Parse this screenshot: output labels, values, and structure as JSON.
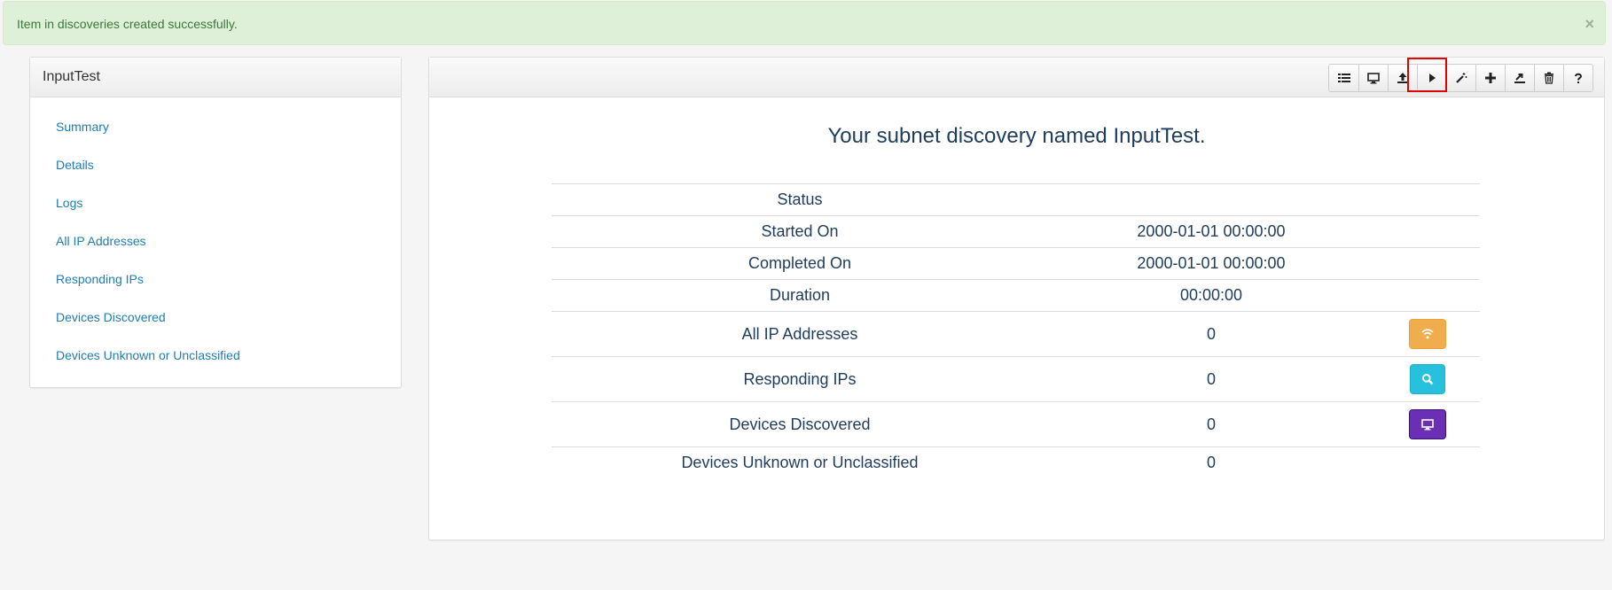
{
  "alert": {
    "message": "Item in discoveries created successfully.",
    "close": "×"
  },
  "sidebar": {
    "title": "InputTest",
    "items": [
      {
        "label": "Summary"
      },
      {
        "label": "Details"
      },
      {
        "label": "Logs"
      },
      {
        "label": "All IP Addresses"
      },
      {
        "label": "Responding IPs"
      },
      {
        "label": "Devices Discovered"
      },
      {
        "label": "Devices Unknown or Unclassified"
      }
    ]
  },
  "toolbar": {
    "buttons": [
      {
        "icon": "list-icon"
      },
      {
        "icon": "monitor-icon"
      },
      {
        "icon": "upload-icon"
      },
      {
        "icon": "play-icon",
        "highlighted": true
      },
      {
        "icon": "magic-wand-icon"
      },
      {
        "icon": "plus-icon"
      },
      {
        "icon": "export-icon"
      },
      {
        "icon": "trash-icon"
      },
      {
        "icon": "help-icon"
      }
    ]
  },
  "main": {
    "title": "Your subnet discovery named InputTest.",
    "rows": [
      {
        "label": "Status",
        "value": ""
      },
      {
        "label": "Started On",
        "value": "2000-01-01 00:00:00"
      },
      {
        "label": "Completed On",
        "value": "2000-01-01 00:00:00"
      },
      {
        "label": "Duration",
        "value": "00:00:00"
      },
      {
        "label": "All IP Addresses",
        "value": "0",
        "action_icon": "wifi-icon",
        "action_color": "#f0ad4e"
      },
      {
        "label": "Responding IPs",
        "value": "0",
        "action_icon": "search-icon",
        "action_color": "#26c2dd"
      },
      {
        "label": "Devices Discovered",
        "value": "0",
        "action_icon": "monitor-icon",
        "action_color": "#6a2fb5"
      },
      {
        "label": "Devices Unknown or Unclassified",
        "value": "0"
      }
    ]
  }
}
